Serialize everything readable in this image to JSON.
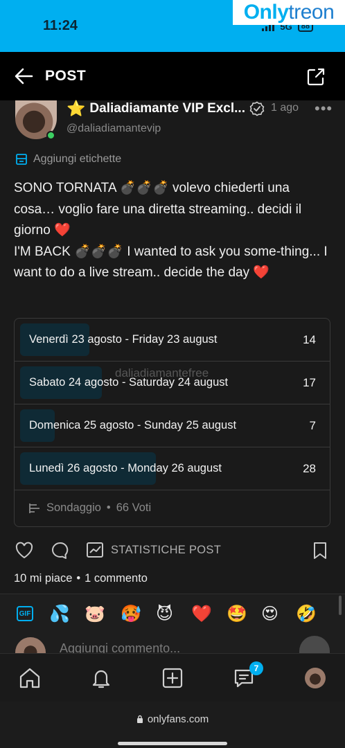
{
  "status_bar": {
    "time": "11:24",
    "network": "5G",
    "battery": "88"
  },
  "watermark": {
    "part1": "Only",
    "part2": "treon"
  },
  "header": {
    "title": "POST"
  },
  "post": {
    "author_name": "Daliadiamante VIP Excl...",
    "author_handle": "@daliadiamantevip",
    "time_ago": "1 ago",
    "tag_label": "Aggiungi etichette",
    "lines": [
      "SONO TORNATA 💣💣💣 volevo chiederti una cosa… voglio fare una diretta streaming.. decidi il giorno ❤️",
      "I'M BACK 💣💣💣 I wanted to ask you some-thing... I want to do a live stream.. decide the day ❤️"
    ]
  },
  "poll": {
    "options": [
      {
        "label": "Venerdì 23 agosto - Friday 23 august",
        "votes": "14",
        "fill": 0.22
      },
      {
        "label": "Sabato 24 agosto - Saturday 24 august",
        "votes": "17",
        "fill": 0.26
      },
      {
        "label": "Domenica 25 agosto - Sunday 25 august",
        "votes": "7",
        "fill": 0.11
      },
      {
        "label": "Lunedì 26 agosto - Monday 26 august",
        "votes": "28",
        "fill": 0.43
      }
    ],
    "type_label": "Sondaggio",
    "separator": "•",
    "votes_label": "66 Voti",
    "overlay_watermark": "daliadiamantefree"
  },
  "actions": {
    "stats_label": "STATISTICHE POST"
  },
  "counts": {
    "likes": "10 mi piace",
    "separator": "•",
    "comments": "1 commento"
  },
  "emoji_bar": {
    "gif": "GIF",
    "emojis": [
      "💦",
      "🐷",
      "🥵",
      "😈",
      "❤️",
      "🤩",
      "😍",
      "🤣"
    ]
  },
  "comment": {
    "placeholder": "Aggiungi commento..."
  },
  "bottom_nav": {
    "messages_badge": "7"
  },
  "browser": {
    "url": "onlyfans.com"
  },
  "colors": {
    "accent": "#00aff0",
    "background": "#1a1a1a",
    "online": "#3ccf62"
  }
}
